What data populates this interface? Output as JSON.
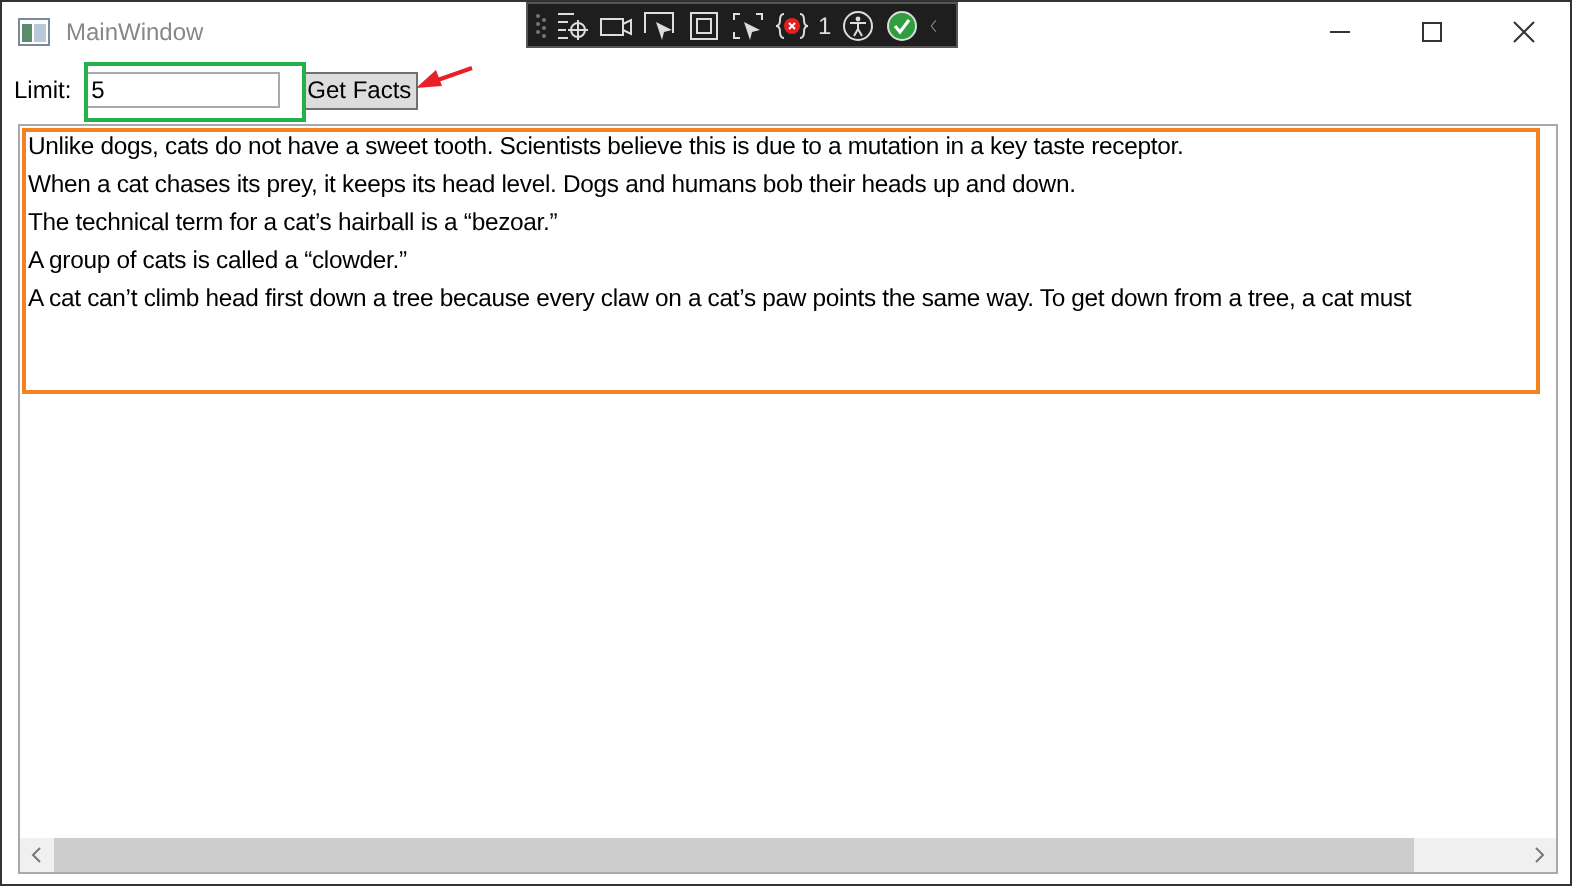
{
  "window": {
    "title": "MainWindow"
  },
  "debug_toolbar": {
    "binding_error_count": "1"
  },
  "form": {
    "limit_label": "Limit:",
    "limit_value": "5",
    "button": "Get Facts"
  },
  "facts": [
    "Unlike dogs, cats do not have a sweet tooth. Scientists believe this is due to a mutation in a key taste receptor.",
    "When a cat chases its prey, it keeps its head level. Dogs and humans bob their heads up and down.",
    "The technical term for a cat’s hairball is a “bezoar.”",
    "A group of cats is called a “clowder.”",
    "A cat can’t climb head first down a tree because every claw on a cat’s paw points the same way. To get down from a tree, a cat must"
  ]
}
